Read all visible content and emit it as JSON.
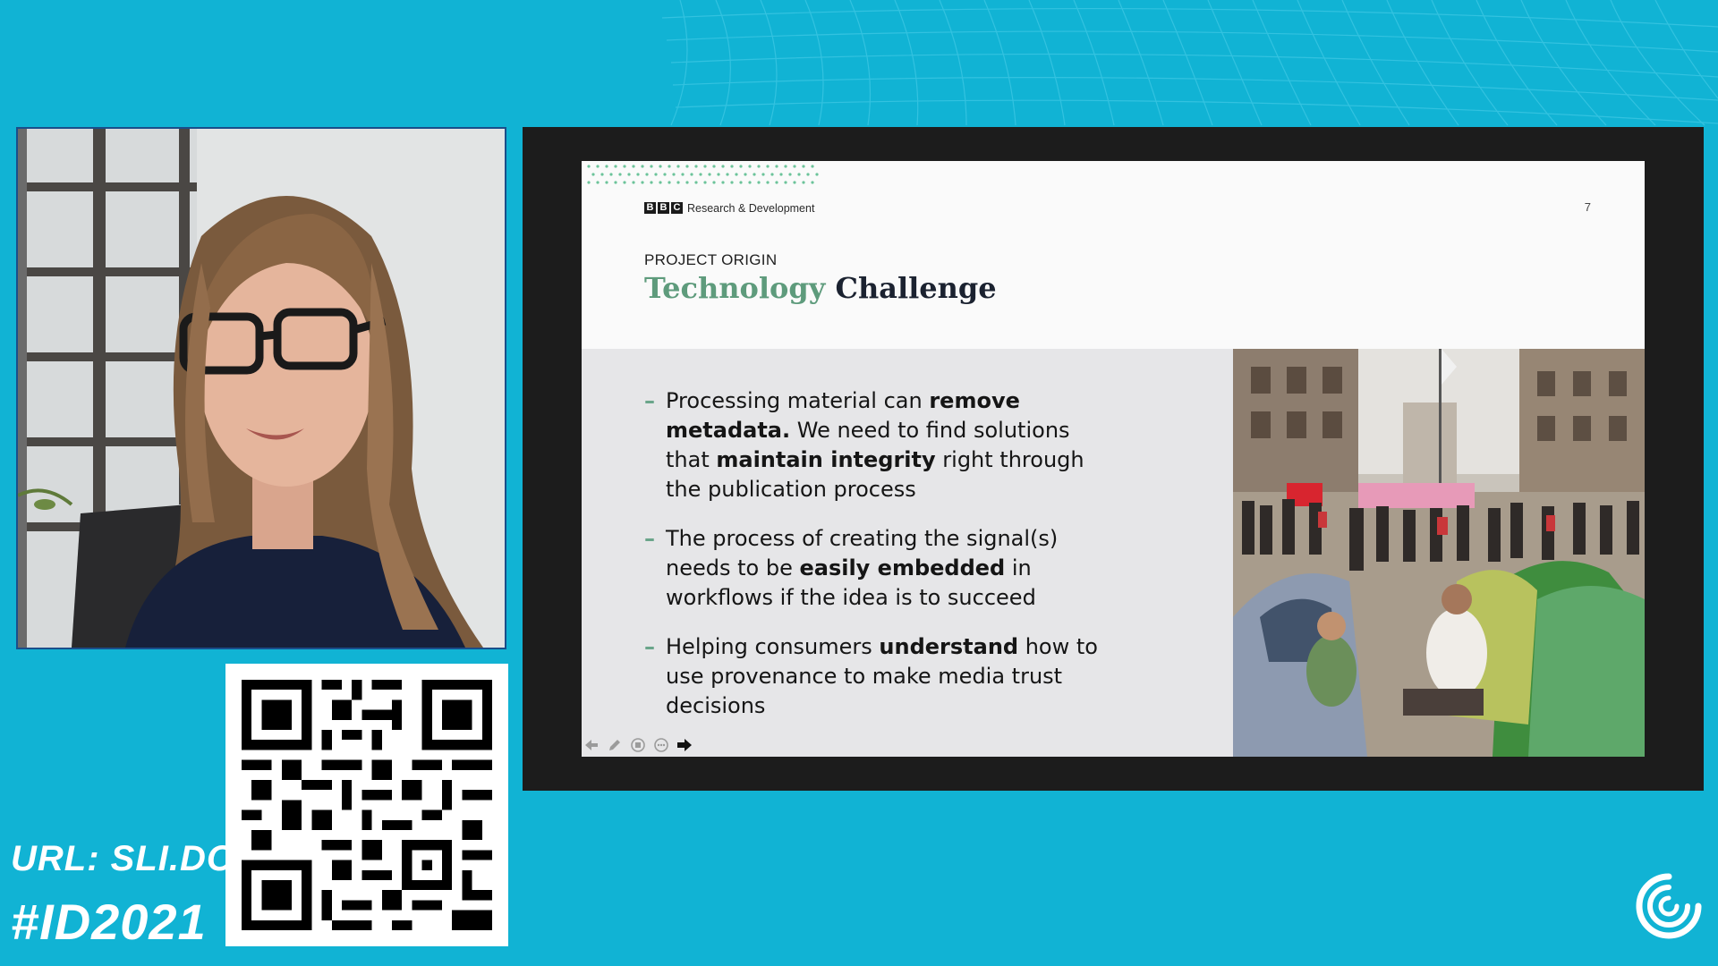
{
  "colors": {
    "background": "#11b3d4",
    "accent_green": "#5e9b7c",
    "title_dark": "#1b2230"
  },
  "webcam": {
    "icon": "speaker-video"
  },
  "branding": {
    "url": "URL: SLI.DO",
    "hashtag": "#ID2021",
    "qr_icon": "qr-code-icon",
    "logo_icon": "swirl-logo-icon"
  },
  "slide": {
    "org_logo": [
      "B",
      "B",
      "C"
    ],
    "org_dept": "Research & Development",
    "page_number": "7",
    "kicker": "PROJECT ORIGIN",
    "title_part1": "Technology",
    "title_part2": "Challenge",
    "bullets": [
      {
        "parts": [
          "Processing material can ",
          "remove metadata.",
          " We need to find solutions that ",
          "maintain integrity",
          " right through the publication process"
        ]
      },
      {
        "parts": [
          "The process of creating the signal(s) needs to be ",
          "easily embedded",
          " in workflows if the idea is to succeed"
        ]
      },
      {
        "parts": [
          "Helping consumers ",
          "understand",
          " how to use provenance to make media trust decisions"
        ]
      }
    ],
    "photo_icon": "street-protest-photo"
  },
  "toolbar": {
    "items": [
      "previous-icon",
      "pen-icon",
      "slides-icon",
      "more-icon",
      "next-icon"
    ]
  }
}
